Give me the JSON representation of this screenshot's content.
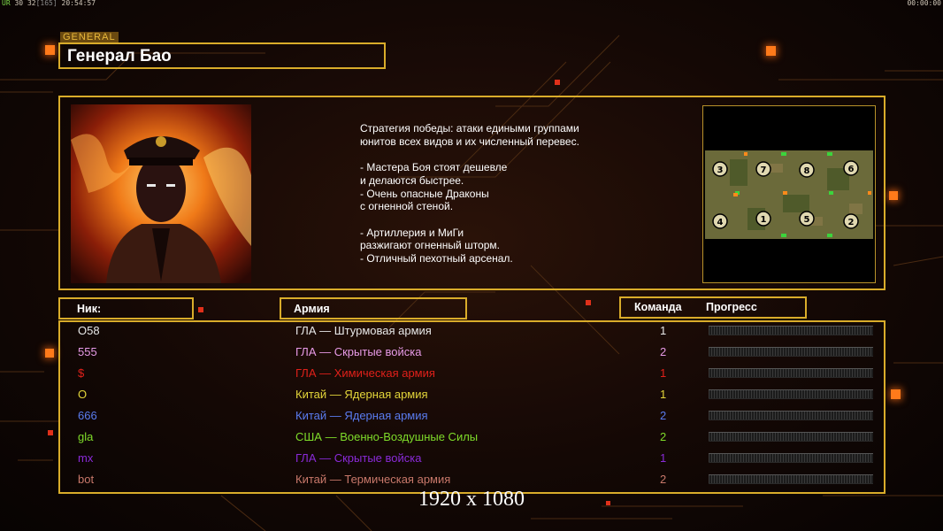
{
  "hud": {
    "left_prefix": "UR",
    "left_a": "30",
    "left_b": "32",
    "left_c": "[165]",
    "clock": "20:54:57",
    "right_timer": "00:00:00"
  },
  "general": {
    "tag": "GENERAL",
    "name": "Генерал Бао",
    "description": "Стратегия победы: атаки едиными группами\nюнитов всех видов и их численный перевес.\n\n- Мастера Боя стоят дешевле\nи делаются быстрее.\n- Очень опасные Драконы\nс огненной стеной.\n\n- Артиллерия и МиГи\nразжигают огненный шторм.\n- Отличный пехотный арсенал."
  },
  "minimap": {
    "slots_top": [
      "3",
      "7",
      "8",
      "6"
    ],
    "slots_bottom": [
      "4",
      "1",
      "5",
      "2"
    ]
  },
  "table": {
    "headers": {
      "nick": "Ник:",
      "army": "Армия",
      "team": "Команда",
      "progress": "Прогресс"
    },
    "rows": [
      {
        "nick": "O58",
        "army": "ГЛА — Штурмовая армия",
        "team": "1",
        "color": "#e8e8e8",
        "progress": 0
      },
      {
        "nick": "555",
        "army": "ГЛА — Скрытые войска",
        "team": "2",
        "color": "#e79ae6",
        "progress": 0
      },
      {
        "nick": "$",
        "army": "ГЛА — Химическая армия",
        "team": "1",
        "color": "#e0201a",
        "progress": 0
      },
      {
        "nick": "O",
        "army": "Китай — Ядерная армия",
        "team": "1",
        "color": "#e3d53a",
        "progress": 0
      },
      {
        "nick": "666",
        "army": "Китай — Ядерная армия",
        "team": "2",
        "color": "#5a7cf0",
        "progress": 0
      },
      {
        "nick": "gla",
        "army": "США — Военно-Воздушные Силы",
        "team": "2",
        "color": "#7fdc2a",
        "progress": 0
      },
      {
        "nick": "mx",
        "army": "ГЛА — Скрытые войска",
        "team": "1",
        "color": "#8a2ad8",
        "progress": 0
      },
      {
        "nick": "bot",
        "army": "Китай — Термическая армия",
        "team": "2",
        "color": "#c8786a",
        "progress": 0
      }
    ]
  },
  "resolution": "1920 x 1080",
  "colors": {
    "frame": "#d9ac2a",
    "accent": "#ff7a1a"
  }
}
